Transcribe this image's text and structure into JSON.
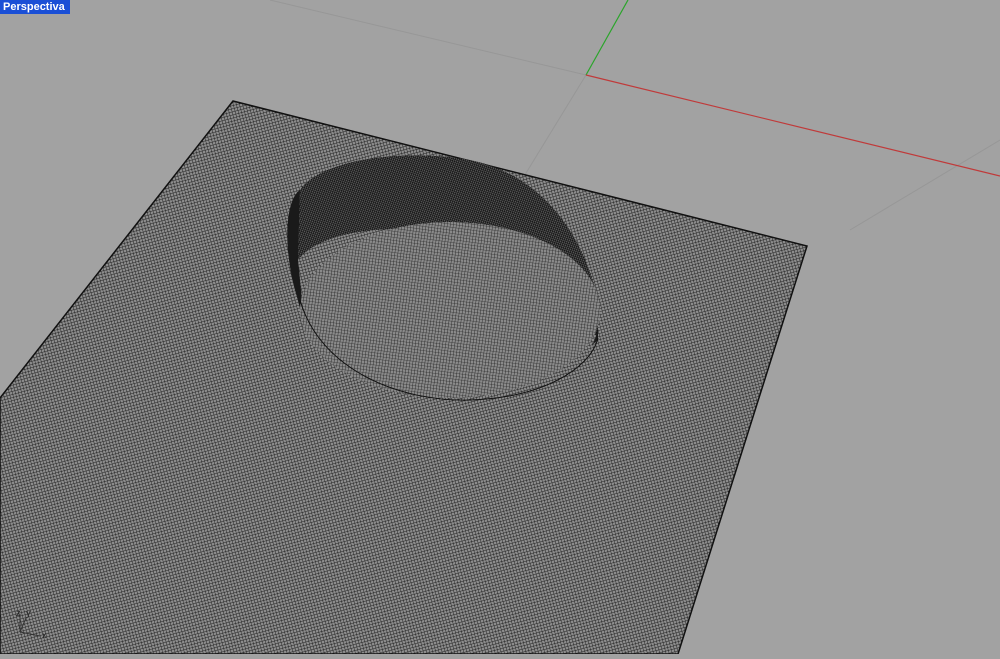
{
  "viewport": {
    "title": "Perspectiva",
    "background_color": "#a2a2a2",
    "title_bg_color": "#1a4fd6",
    "x_axis_color": "#c03a3a",
    "y_axis_color": "#2aa52a",
    "grid_color": "#979797",
    "mesh_color": "#111111"
  },
  "axis_gizmo": {
    "y_label": "y",
    "z_label": "z",
    "x_label": "x"
  }
}
